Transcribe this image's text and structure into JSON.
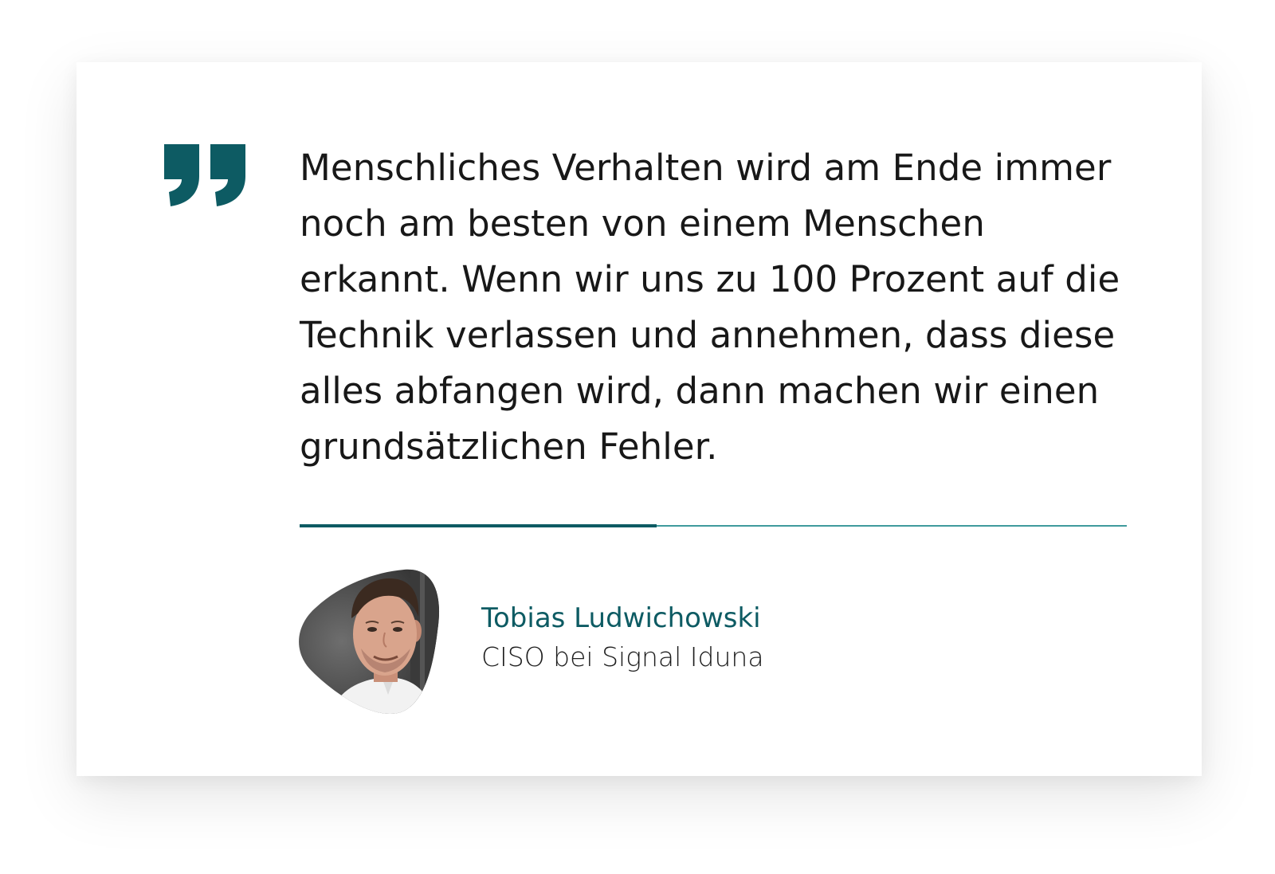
{
  "testimonial": {
    "quote": "Menschliches Verhalten wird am Ende immer noch am besten von einem Menschen erkannt. Wenn wir uns zu 100 Prozent auf die Technik verlassen und annehmen, dass diese alles abfangen wird, dann machen wir einen grundsätzlichen Fehler.",
    "author_name": "Tobias Ludwichowski",
    "author_role": "CISO bei Signal Iduna"
  },
  "icons": {
    "quote_mark": "closing-quote-icon",
    "avatar": "author-portrait"
  },
  "colors": {
    "accent": "#0d5b63",
    "divider_light": "#3f9a9c",
    "text": "#181818"
  }
}
